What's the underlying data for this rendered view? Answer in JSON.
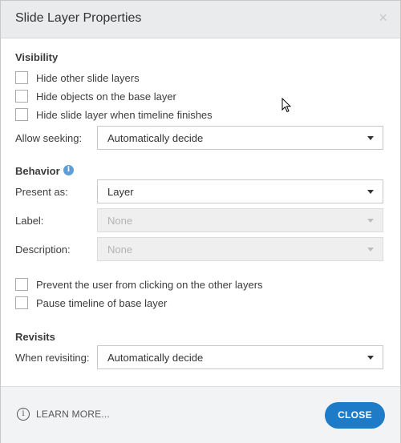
{
  "dialog": {
    "title": "Slide Layer Properties",
    "close_glyph": "×"
  },
  "visibility": {
    "heading": "Visibility",
    "options": [
      {
        "label": "Hide other slide layers",
        "checked": false
      },
      {
        "label": "Hide objects on the base layer",
        "checked": false
      },
      {
        "label": "Hide slide layer when timeline finishes",
        "checked": false
      }
    ],
    "allow_seeking": {
      "label": "Allow seeking:",
      "value": "Automatically decide"
    }
  },
  "behavior": {
    "heading": "Behavior",
    "info_icon": "info-icon",
    "present_as": {
      "label": "Present as:",
      "value": "Layer"
    },
    "label_field": {
      "label": "Label:",
      "value": "None",
      "disabled": true
    },
    "description": {
      "label": "Description:",
      "value": "None",
      "disabled": true
    },
    "options": [
      {
        "label": "Prevent the user from clicking on the other layers",
        "checked": false
      },
      {
        "label": "Pause timeline of base layer",
        "checked": false
      }
    ]
  },
  "revisits": {
    "heading": "Revisits",
    "when_revisiting": {
      "label": "When revisiting:",
      "value": "Automatically decide"
    }
  },
  "footer": {
    "learn_more": "LEARN MORE...",
    "close_button": "CLOSE"
  },
  "colors": {
    "accent": "#1e7bc7",
    "info": "#5d9ed9",
    "titlebar": "#e9ebed"
  }
}
